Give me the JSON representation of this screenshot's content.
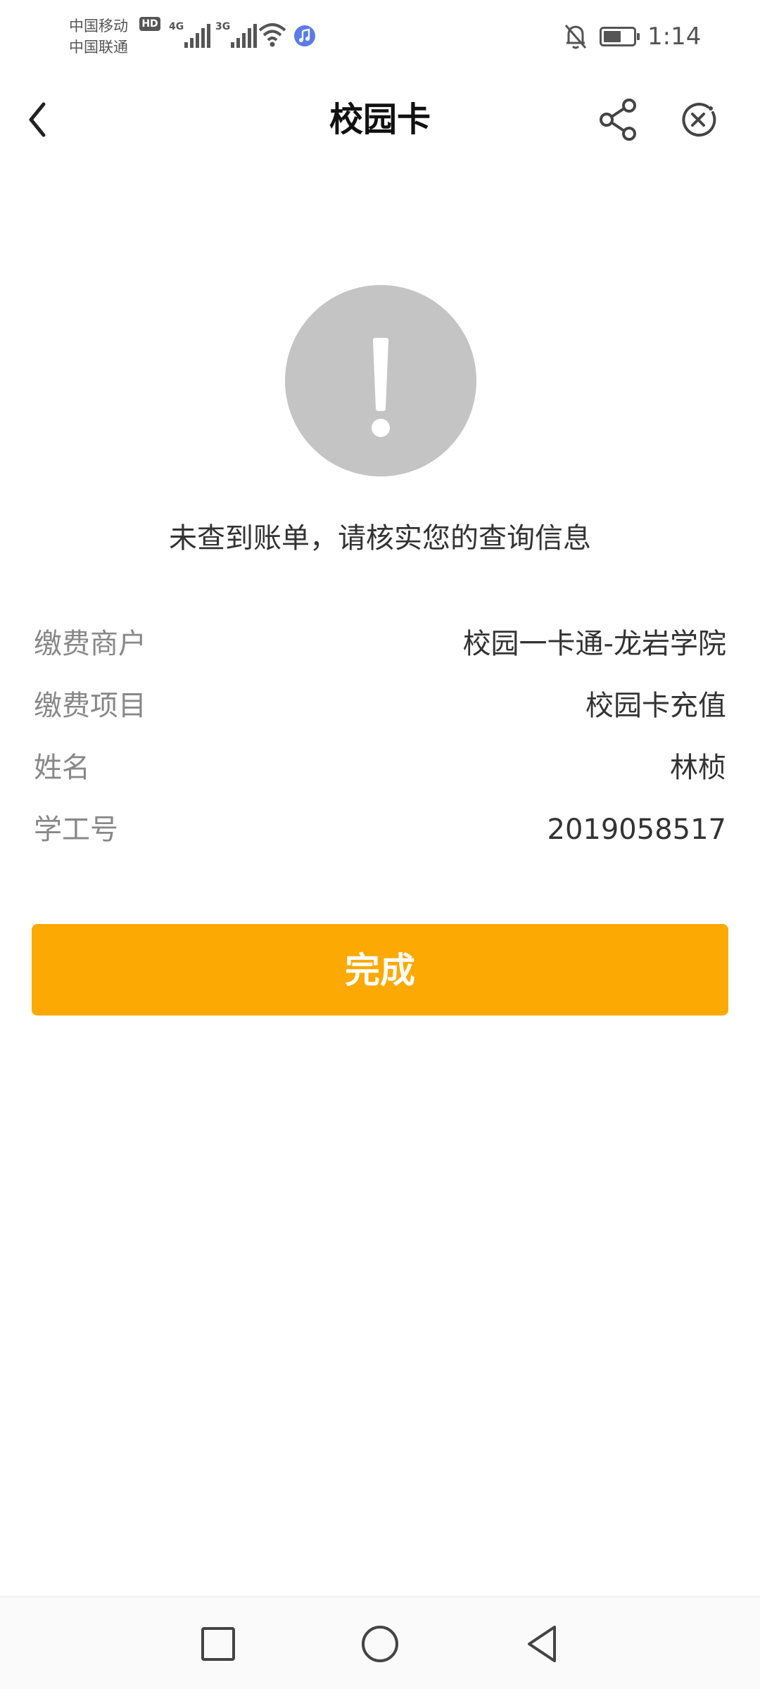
{
  "status_bar": {
    "carrier_1": "中国移动",
    "carrier_2": "中国联通",
    "hd_badge": "HD",
    "network_1": "4G",
    "network_2": "3G",
    "time": "1:14",
    "icons": [
      "signal-icon",
      "wifi-icon",
      "music-icon",
      "bell-off-icon",
      "battery-icon"
    ]
  },
  "nav": {
    "title": "校园卡",
    "icons": [
      "back-arrow-icon",
      "share-icon",
      "close-circle-icon"
    ]
  },
  "result": {
    "icon": "exclamation-icon",
    "message": "未查到账单，请核实您的查询信息"
  },
  "info": {
    "rows": [
      {
        "label": "缴费商户",
        "value": "校园一卡通-龙岩学院"
      },
      {
        "label": "缴费项目",
        "value": "校园卡充值"
      },
      {
        "label": "姓名",
        "value": "林桢"
      },
      {
        "label": "学工号",
        "value": "2019058517"
      }
    ]
  },
  "actions": {
    "done_label": "完成"
  },
  "system_nav": {
    "icons": [
      "recent-apps-icon",
      "home-icon",
      "back-triangle-icon"
    ]
  },
  "colors": {
    "accent": "#fca903",
    "alert_circle": "#c4c4c4",
    "label_text": "#888888",
    "value_text": "#333333"
  }
}
